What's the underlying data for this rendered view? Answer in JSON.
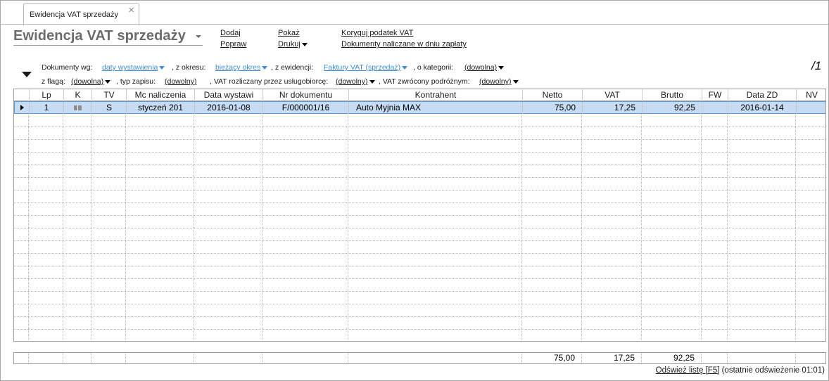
{
  "tab": {
    "label": "Ewidencja VAT sprzedaży",
    "close": "×"
  },
  "header": {
    "title": "Ewidencja VAT sprzedaży",
    "menu": {
      "dodaj": "Dodaj",
      "popraw": "Popraw",
      "pokaz": "Pokaż",
      "drukuj": "Drukuj",
      "koryguj": "Koryguj podatek VAT",
      "dokumenty_naliczane": "Dokumenty naliczane w dniu zapłaty"
    }
  },
  "filters": {
    "dokumenty_wg_label": "Dokumenty wg:",
    "dokumenty_wg_value": "daty wystawienia",
    "okres_label": ", z okresu:",
    "okres_value": "bieżący okres",
    "ewidencji_label": ", z ewidencji:",
    "ewidencji_value": "Faktury VAT (sprzedaż)",
    "kategorii_label": ", o kategorii:",
    "kategorii_value": "(dowolna)",
    "flaga_label": "z flagą:",
    "flaga_value": "(dowolna)",
    "typ_label": ", typ zapisu:",
    "typ_value": "(dowolny)",
    "uslugobiorca_label": ", VAT rozliczany przez usługobiorcę:",
    "uslugobiorca_value": "(dowolny)",
    "podrozny_label": ", VAT zwrócony podróżnym:",
    "podrozny_value": "(dowolny)",
    "page_indicator": "/1"
  },
  "table": {
    "columns": [
      "Lp",
      "K",
      "TV",
      "Mc naliczenia",
      "Data wystawi",
      "Nr dokumentu",
      "Kontrahent",
      "Netto",
      "VAT",
      "Brutto",
      "FW",
      "Data ZD",
      "NV"
    ],
    "rows": [
      {
        "lp": "1",
        "k": "book-icon",
        "tv": "S",
        "mc": "styczeń 201",
        "data": "2016-01-08",
        "nr": "F/000001/16",
        "kontrahent": "Auto Myjnia MAX",
        "netto": "75,00",
        "vat": "17,25",
        "brutto": "92,25",
        "fw": "",
        "data_zd": "2016-01-14",
        "nv": ""
      }
    ]
  },
  "totals": {
    "netto": "75,00",
    "vat": "17,25",
    "brutto": "92,25"
  },
  "status": {
    "refresh_link": "Odśwież listę [F5]",
    "refresh_info": " (ostatnie odświeżenie 01:01)"
  },
  "colors": {
    "selected_row": "#c7dcf3",
    "selected_border": "#5d9ad6",
    "filter_link": "#3a8dd6",
    "title": "#6b6b6b"
  }
}
